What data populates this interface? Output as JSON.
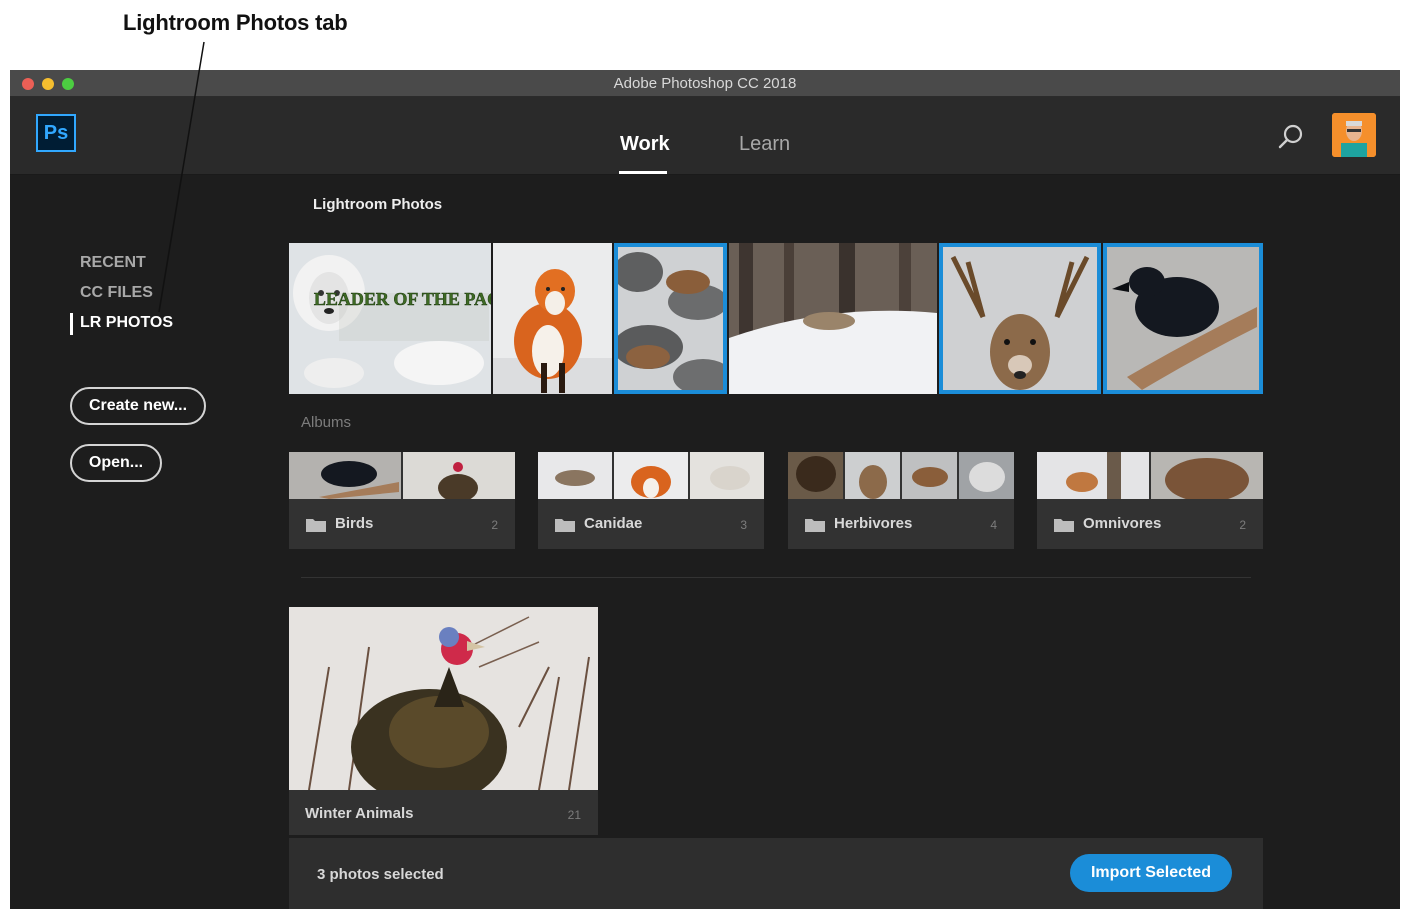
{
  "annotation": {
    "callout": "Lightroom Photos tab"
  },
  "window": {
    "title": "Adobe Photoshop CC 2018"
  },
  "header": {
    "logo_text": "Ps",
    "tabs": [
      {
        "label": "Work",
        "active": true
      },
      {
        "label": "Learn",
        "active": false
      }
    ],
    "icons": {
      "search": "search-icon",
      "avatar": "user-avatar"
    }
  },
  "sidebar": {
    "items": [
      {
        "label": "RECENT",
        "active": false
      },
      {
        "label": "CC FILES",
        "active": false
      },
      {
        "label": "LR PHOTOS",
        "active": true
      }
    ],
    "create_label": "Create new...",
    "open_label": "Open..."
  },
  "main": {
    "section_title": "Lightroom Photos",
    "photos": [
      {
        "subject": "wolf-poster",
        "selected": false,
        "caption": "LEADER OF THE PACK"
      },
      {
        "subject": "red-fox",
        "selected": false
      },
      {
        "subject": "mountain-goats",
        "selected": true
      },
      {
        "subject": "coyote-snow",
        "selected": false
      },
      {
        "subject": "deer",
        "selected": true
      },
      {
        "subject": "raven",
        "selected": true
      }
    ],
    "albums_label": "Albums",
    "albums": [
      {
        "name": "Birds",
        "count": "2"
      },
      {
        "name": "Canidae",
        "count": "3"
      },
      {
        "name": "Herbivores",
        "count": "4"
      },
      {
        "name": "Omnivores",
        "count": "2"
      }
    ],
    "collection": {
      "name": "Winter Animals",
      "count": "21"
    }
  },
  "footer": {
    "selected_text": "3 photos selected",
    "import_label": "Import Selected"
  },
  "colors": {
    "accent": "#1b8dd8",
    "background": "#1d1d1d",
    "panel": "#323232",
    "ps_blue": "#31a8ff"
  }
}
